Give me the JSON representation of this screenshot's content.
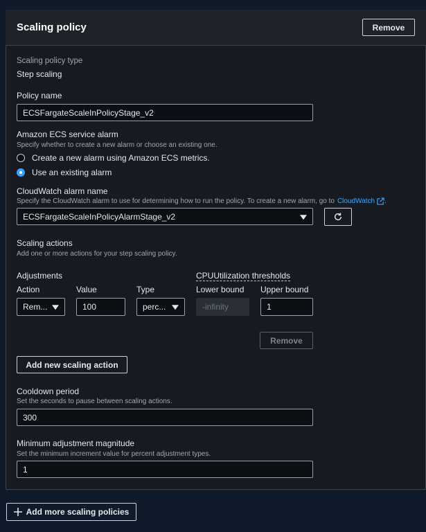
{
  "header": {
    "title": "Scaling policy",
    "remove_label": "Remove"
  },
  "policy_type": {
    "label": "Scaling policy type",
    "value": "Step scaling"
  },
  "policy_name": {
    "label": "Policy name",
    "value": "ECSFargateScaleInPolicyStage_v2"
  },
  "service_alarm": {
    "label": "Amazon ECS service alarm",
    "description": "Specify whether to create a new alarm or choose an existing one.",
    "options": [
      {
        "label": "Create a new alarm using Amazon ECS metrics.",
        "selected": false
      },
      {
        "label": "Use an existing alarm",
        "selected": true
      }
    ]
  },
  "cloudwatch_alarm": {
    "label": "CloudWatch alarm name",
    "description": "Specify the CloudWatch alarm to use for determining how to run the policy. To create a new alarm, go to",
    "link_text": "CloudWatch",
    "description_end": ".",
    "value": "ECSFargateScaleInPolicyAlarmStage_v2"
  },
  "scaling_actions": {
    "label": "Scaling actions",
    "description": "Add one or more actions for your step scaling policy.",
    "adjustments_label": "Adjustments",
    "thresholds_label": "CPUUtilization thresholds",
    "col_action": "Action",
    "col_value": "Value",
    "col_type": "Type",
    "col_lower": "Lower bound",
    "col_upper": "Upper bound",
    "row": {
      "action": "Rem...",
      "value": "100",
      "type": "perc...",
      "lower_placeholder": "-infinity",
      "upper": "1"
    },
    "remove_label": "Remove",
    "add_label": "Add new scaling action"
  },
  "cooldown": {
    "label": "Cooldown period",
    "description": "Set the seconds to pause between scaling actions.",
    "value": "300"
  },
  "min_adjustment": {
    "label": "Minimum adjustment magnitude",
    "description": "Set the minimum increment value for percent adjustment types.",
    "value": "1"
  },
  "footer": {
    "add_policies_label": "Add more scaling policies"
  },
  "colors": {
    "accent": "#39a0ff",
    "link": "#3aa7ff",
    "panel_bg": "#171a21",
    "page_bg": "#0f1b2a"
  }
}
